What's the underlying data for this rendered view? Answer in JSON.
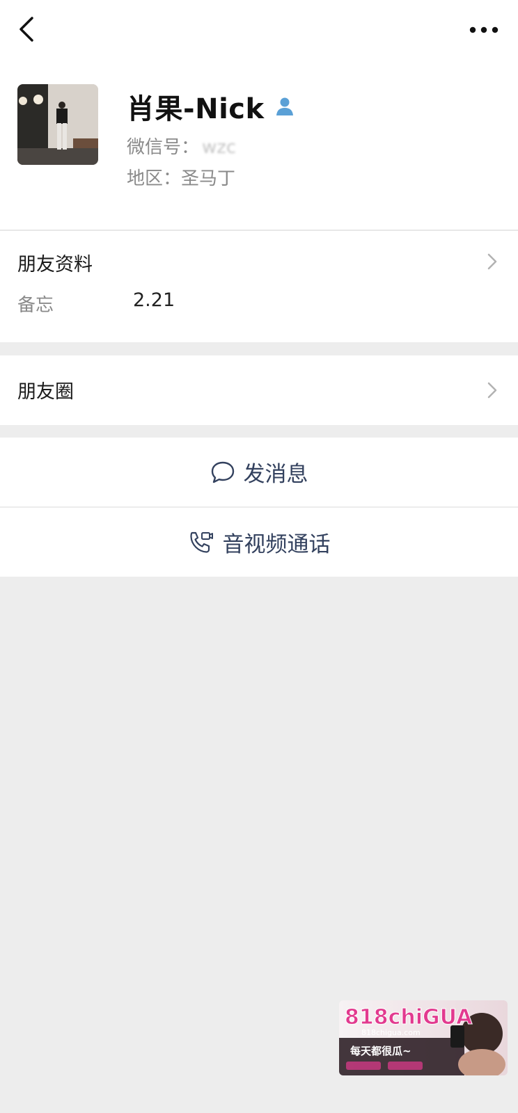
{
  "header": {
    "back_icon": "chevron-left-icon",
    "more_icon": "more-dots-icon"
  },
  "profile": {
    "name": "肖果-Nick",
    "wechat_id_label": "微信号：",
    "wechat_id_value": "wzc",
    "region_label": "地区：",
    "region_value": "圣马丁",
    "badge_icon": "contact-person-icon"
  },
  "friend_info": {
    "title": "朋友资料",
    "remark_label": "备忘",
    "remark_value": "2.21"
  },
  "moments": {
    "title": "朋友圈"
  },
  "actions": {
    "message_label": "发消息",
    "call_label": "音视频通话"
  },
  "watermark": {
    "brand": "818chiGUA",
    "site": "818chigua.com",
    "slogan": "每天都很瓜~"
  },
  "colors": {
    "background": "#ededed",
    "card": "#ffffff",
    "action_text": "#33415e",
    "badge": "#5aa0d6",
    "brand_pink": "#e23a8f"
  }
}
